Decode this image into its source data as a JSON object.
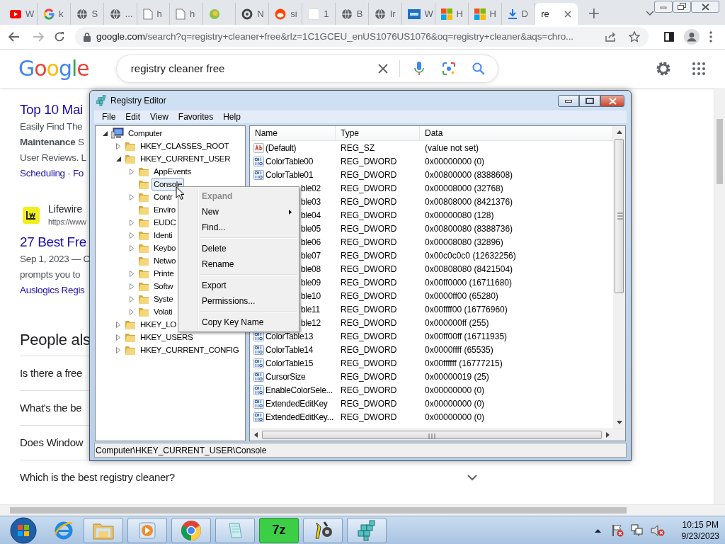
{
  "browser": {
    "tabs": [
      {
        "kind": "youtube",
        "label": "W",
        "selected": false
      },
      {
        "kind": "google",
        "label": "k",
        "selected": false
      },
      {
        "kind": "globe",
        "label": "S",
        "selected": false
      },
      {
        "kind": "globe",
        "label": "...",
        "selected": false
      },
      {
        "kind": "page",
        "label": "h",
        "selected": false
      },
      {
        "kind": "page",
        "label": "h",
        "selected": false
      },
      {
        "kind": "leaf",
        "selected": false
      },
      {
        "kind": "ring",
        "label": "N",
        "selected": false
      },
      {
        "kind": "reddit",
        "label": "si",
        "selected": false
      },
      {
        "kind": "blank",
        "label": "1",
        "selected": false
      },
      {
        "kind": "globe",
        "label": "B",
        "selected": false
      },
      {
        "kind": "globe",
        "label": "Ir",
        "selected": false
      },
      {
        "kind": "paz",
        "label": "W",
        "selected": false
      },
      {
        "kind": "windows",
        "label": "H",
        "selected": false
      },
      {
        "kind": "windows",
        "label": "H",
        "selected": false
      },
      {
        "kind": "download",
        "label": "D",
        "selected": false
      },
      {
        "kind": "none",
        "label": "re",
        "selected": true
      }
    ],
    "address": {
      "host": "google.com",
      "path": "/search?q=registry+cleaner+free&rlz=1C1GCEU_enUS1076US1076&oq=registry+cleaner&aqs=chro..."
    }
  },
  "google": {
    "logo": "Google",
    "query": "registry cleaner free",
    "results": [
      {
        "title": "Top 10 Mai",
        "snippet": [
          "Easily Find The",
          "**Maintenance** S",
          "User Reviews. L"
        ],
        "links": "Scheduling · Fo"
      },
      {
        "site": "Lifewire",
        "url": "https://www",
        "title": "27 Best Fre",
        "snippet": [
          "Sep 1, 2023 — C",
          "prompts you to"
        ],
        "links": "Auslogics Regis"
      }
    ],
    "people_also_ask": {
      "heading": "People als",
      "questions": [
        {
          "text": "Is there a free"
        },
        {
          "text": "What's the be"
        },
        {
          "text": "Does Window"
        },
        {
          "text": "Which is the best registry cleaner?",
          "expanded": false
        }
      ]
    }
  },
  "registry_editor": {
    "title": "Registry Editor",
    "menu": [
      "File",
      "Edit",
      "View",
      "Favorites",
      "Help"
    ],
    "tree": [
      {
        "label": "Computer",
        "kind": "computer",
        "expanded": true,
        "selected": false,
        "children": [
          {
            "label": "HKEY_CLASSES_ROOT",
            "kind": "folder",
            "expanded": false,
            "selected": false
          },
          {
            "label": "HKEY_CURRENT_USER",
            "kind": "folder",
            "expanded": true,
            "selected": false,
            "children": [
              {
                "label": "AppEvents",
                "kind": "folder",
                "expanded": false,
                "selected": false
              },
              {
                "label": "Console",
                "kind": "leaf",
                "selected": true
              },
              {
                "label": "Contr",
                "kind": "folder",
                "expanded": false,
                "selected": false
              },
              {
                "label": "Enviro",
                "kind": "leaf",
                "selected": false
              },
              {
                "label": "EUDC",
                "kind": "folder",
                "expanded": false,
                "selected": false
              },
              {
                "label": "Identi",
                "kind": "folder",
                "expanded": false,
                "selected": false
              },
              {
                "label": "Keybo",
                "kind": "folder",
                "expanded": false,
                "selected": false
              },
              {
                "label": "Netwo",
                "kind": "leaf",
                "selected": false
              },
              {
                "label": "Printe",
                "kind": "folder",
                "expanded": false,
                "selected": false
              },
              {
                "label": "Softw",
                "kind": "folder",
                "expanded": false,
                "selected": false
              },
              {
                "label": "Syste",
                "kind": "folder",
                "expanded": false,
                "selected": false
              },
              {
                "label": "Volati",
                "kind": "folder",
                "expanded": false,
                "selected": false
              }
            ]
          },
          {
            "label": "HKEY_LO",
            "kind": "folder",
            "expanded": false,
            "selected": false
          },
          {
            "label": "HKEY_USERS",
            "kind": "folder",
            "expanded": false,
            "selected": false
          },
          {
            "label": "HKEY_CURRENT_CONFIG",
            "kind": "folder",
            "expanded": false,
            "selected": false
          }
        ]
      }
    ],
    "columns": [
      "Name",
      "Type",
      "Data"
    ],
    "values": [
      {
        "kind": "string",
        "name": "(Default)",
        "type": "REG_SZ",
        "data": "(value not set)"
      },
      {
        "kind": "dword",
        "name": "ColorTable00",
        "type": "REG_DWORD",
        "data": "0x00000000 (0)"
      },
      {
        "kind": "dword",
        "name": "ColorTable01",
        "type": "REG_DWORD",
        "data": "0x00800000 (8388608)"
      },
      {
        "kind": "covered",
        "name": "ble02",
        "type": "REG_DWORD",
        "data": "0x00008000 (32768)"
      },
      {
        "kind": "covered",
        "name": "ble03",
        "type": "REG_DWORD",
        "data": "0x00808000 (8421376)"
      },
      {
        "kind": "covered",
        "name": "ble04",
        "type": "REG_DWORD",
        "data": "0x00000080 (128)"
      },
      {
        "kind": "covered",
        "name": "ble05",
        "type": "REG_DWORD",
        "data": "0x00800080 (8388736)"
      },
      {
        "kind": "covered",
        "name": "ble06",
        "type": "REG_DWORD",
        "data": "0x00008080 (32896)"
      },
      {
        "kind": "covered",
        "name": "ble07",
        "type": "REG_DWORD",
        "data": "0x00c0c0c0 (12632256)"
      },
      {
        "kind": "covered",
        "name": "ble08",
        "type": "REG_DWORD",
        "data": "0x00808080 (8421504)"
      },
      {
        "kind": "covered",
        "name": "ble09",
        "type": "REG_DWORD",
        "data": "0x00ff0000 (16711680)"
      },
      {
        "kind": "covered",
        "name": "ble10",
        "type": "REG_DWORD",
        "data": "0x0000ff00 (65280)"
      },
      {
        "kind": "covered",
        "name": "ble11",
        "type": "REG_DWORD",
        "data": "0x00ffff00 (16776960)"
      },
      {
        "kind": "covered",
        "name": "ble12",
        "type": "REG_DWORD",
        "data": "0x000000ff (255)"
      },
      {
        "kind": "dword",
        "name": "ColorTable13",
        "type": "REG_DWORD",
        "data": "0x00ff00ff (16711935)"
      },
      {
        "kind": "dword",
        "name": "ColorTable14",
        "type": "REG_DWORD",
        "data": "0x0000ffff (65535)"
      },
      {
        "kind": "dword",
        "name": "ColorTable15",
        "type": "REG_DWORD",
        "data": "0x00ffffff (16777215)"
      },
      {
        "kind": "dword",
        "name": "CursorSize",
        "type": "REG_DWORD",
        "data": "0x00000019 (25)"
      },
      {
        "kind": "dword",
        "name": "EnableColorSele...",
        "type": "REG_DWORD",
        "data": "0x00000000 (0)"
      },
      {
        "kind": "dword",
        "name": "ExtendedEditKey",
        "type": "REG_DWORD",
        "data": "0x00000000 (0)"
      },
      {
        "kind": "dword",
        "name": "ExtendedEditKey...",
        "type": "REG_DWORD",
        "data": "0x00000000 (0)"
      }
    ],
    "status": "Computer\\HKEY_CURRENT_USER\\Console"
  },
  "context_menu": {
    "items": [
      {
        "kind": "item",
        "label": "Expand",
        "disabled": true,
        "default": true,
        "submenu": false
      },
      {
        "kind": "item",
        "label": "New",
        "disabled": false,
        "default": false,
        "submenu": true
      },
      {
        "kind": "item",
        "label": "Find...",
        "disabled": false,
        "default": false,
        "submenu": false
      },
      {
        "kind": "separator"
      },
      {
        "kind": "item",
        "label": "Delete",
        "disabled": false,
        "default": false,
        "submenu": false
      },
      {
        "kind": "item",
        "label": "Rename",
        "disabled": false,
        "default": false,
        "submenu": false
      },
      {
        "kind": "separator"
      },
      {
        "kind": "item",
        "label": "Export",
        "disabled": false,
        "default": false,
        "submenu": false
      },
      {
        "kind": "item",
        "label": "Permissions...",
        "disabled": false,
        "default": false,
        "submenu": false
      },
      {
        "kind": "separator"
      },
      {
        "kind": "item",
        "label": "Copy Key Name",
        "disabled": false,
        "default": false,
        "submenu": false
      }
    ]
  },
  "taskbar": {
    "apps": [
      {
        "kind": "ie",
        "running": false
      },
      {
        "kind": "explorer",
        "running": true
      },
      {
        "kind": "media",
        "running": true
      },
      {
        "kind": "chrome",
        "running": true
      },
      {
        "kind": "notepad",
        "running": true
      },
      {
        "kind": "sevenzip",
        "label": "7z",
        "running": true
      },
      {
        "kind": "tools",
        "running": true
      },
      {
        "kind": "registry",
        "running": true
      }
    ],
    "time": "10:15 PM",
    "date": "9/23/2023"
  }
}
